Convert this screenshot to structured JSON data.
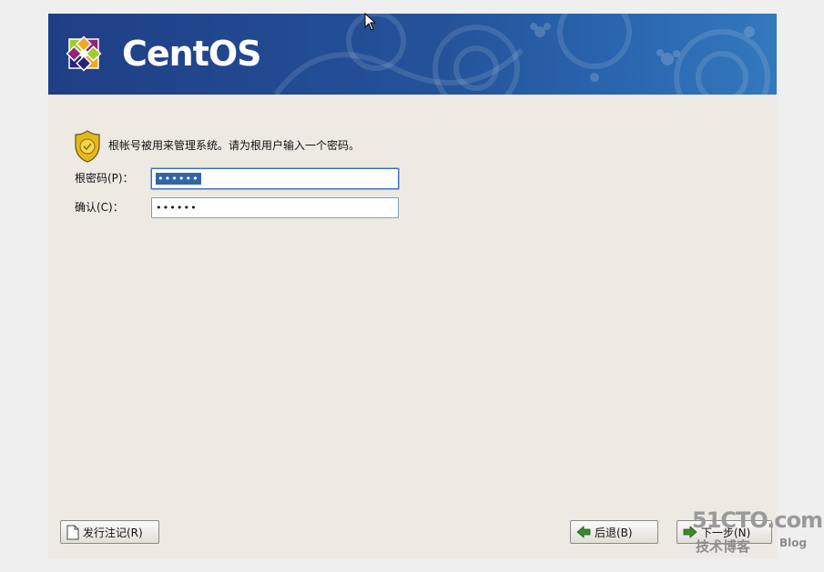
{
  "banner": {
    "logo_text": "CentOS"
  },
  "message": {
    "text": "根帐号被用来管理系统。请为根用户输入一个密码。",
    "icon": "security-badge-icon"
  },
  "fields": {
    "root_password": {
      "label": "根密码(P)：",
      "value": "••••••"
    },
    "confirm": {
      "label": "确认(C)：",
      "value": "••••••"
    }
  },
  "buttons": {
    "release_notes": "发行注记(R)",
    "back": "后退(B)",
    "next": "下一步(N)"
  },
  "watermark": {
    "top": "51CTO.com",
    "bottom": "技术博客",
    "blog": "Blog"
  },
  "colors": {
    "banner": "#24539a",
    "selection": "#3465a4",
    "background": "#edeae4"
  }
}
